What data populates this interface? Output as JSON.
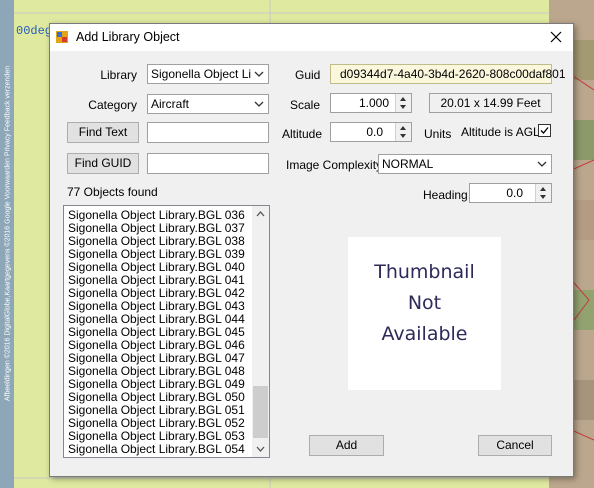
{
  "background": {
    "map_text": "00deg",
    "attribution": "Afbeeldingen ©2016 DigitalGlobe,Kaartgegevens ©2016 Google  Voorwaarden  Privacy  Feedback verzenden"
  },
  "dialog": {
    "title": "Add Library Object",
    "close_icon": "close-icon"
  },
  "form": {
    "library_label": "Library",
    "library_value": "Sigonella Object Libra",
    "category_label": "Category",
    "category_value": "Aircraft",
    "find_text_button": "Find Text",
    "find_text_value": "",
    "find_guid_button": "Find GUID",
    "find_guid_value": "",
    "objects_found": "77 Objects found",
    "guid_label": "Guid",
    "guid_value": "d09344d7-4a40-3b4d-2620-808c00daf801",
    "scale_label": "Scale",
    "scale_value": "1.000",
    "size_value": "20.01 x 14.99 Feet",
    "altitude_label": "Altitude",
    "altitude_value": "0.0",
    "units_label": "Units",
    "altitude_agl_label": "Altitude is AGL",
    "altitude_agl_checked": true,
    "image_complexity_label": "Image Complexity",
    "image_complexity_value": "NORMAL",
    "heading_label": "Heading",
    "heading_value": "0.0"
  },
  "list": {
    "items": [
      "Sigonella Object Library.BGL 036",
      "Sigonella Object Library.BGL 037",
      "Sigonella Object Library.BGL 038",
      "Sigonella Object Library.BGL 039",
      "Sigonella Object Library.BGL 040",
      "Sigonella Object Library.BGL 041",
      "Sigonella Object Library.BGL 042",
      "Sigonella Object Library.BGL 043",
      "Sigonella Object Library.BGL 044",
      "Sigonella Object Library.BGL 045",
      "Sigonella Object Library.BGL 046",
      "Sigonella Object Library.BGL 047",
      "Sigonella Object Library.BGL 048",
      "Sigonella Object Library.BGL 049",
      "Sigonella Object Library.BGL 050",
      "Sigonella Object Library.BGL 051",
      "Sigonella Object Library.BGL 052",
      "Sigonella Object Library.BGL 053",
      "Sigonella Object Library.BGL 054"
    ]
  },
  "thumbnail": {
    "line1": "Thumbnail",
    "line2": "Not",
    "line3": "Available"
  },
  "buttons": {
    "add": "Add",
    "cancel": "Cancel"
  },
  "colors": {
    "guid_background": "#fbf7dd",
    "dialog_background": "#f0f0f0",
    "thumbnail_text": "#2d2a5a"
  }
}
